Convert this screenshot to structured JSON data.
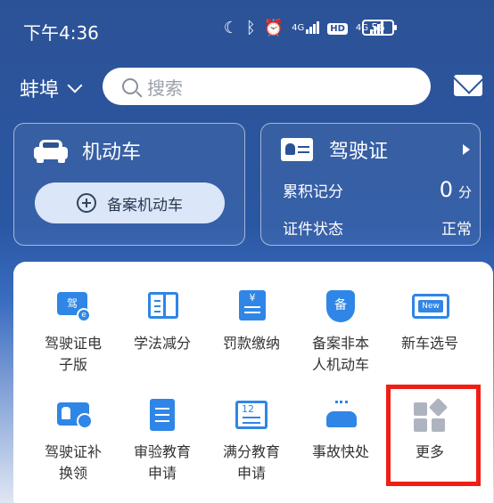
{
  "status_bar": {
    "time": "下午4:36",
    "network_label": "4G",
    "hd_label": "HD",
    "battery": "56"
  },
  "header": {
    "city": "蚌埠",
    "search_placeholder": "搜索"
  },
  "vehicle_card": {
    "title": "机动车",
    "register_button": "备案机动车"
  },
  "license_card": {
    "title": "驾驶证",
    "points_label": "累积记分",
    "points_value": "0",
    "points_unit": "分",
    "status_label": "证件状态",
    "status_value": "正常"
  },
  "services": [
    {
      "label": "驾驶证电\n子版",
      "icon": "e-license-icon",
      "glyph": "驾"
    },
    {
      "label": "学法减分",
      "icon": "book-icon"
    },
    {
      "label": "罚款缴纳",
      "icon": "fine-receipt-icon",
      "glyph": "¥"
    },
    {
      "label": "备案非本\n人机动车",
      "icon": "register-shield-icon",
      "glyph": "备"
    },
    {
      "label": "新车选号",
      "icon": "new-plate-icon",
      "glyph": "New"
    },
    {
      "label": "驾驶证补\n换领",
      "icon": "license-renew-icon"
    },
    {
      "label": "审验教育\n申请",
      "icon": "review-doc-icon"
    },
    {
      "label": "满分教育\n申请",
      "icon": "full-score-calendar-icon",
      "glyph": "12"
    },
    {
      "label": "事故快处",
      "icon": "accident-icon"
    },
    {
      "label": "更多",
      "icon": "more-grid-icon"
    }
  ],
  "colors": {
    "primary_blue": "#2c5296",
    "icon_blue": "#2f86e6",
    "highlight_red": "#f01e14"
  }
}
